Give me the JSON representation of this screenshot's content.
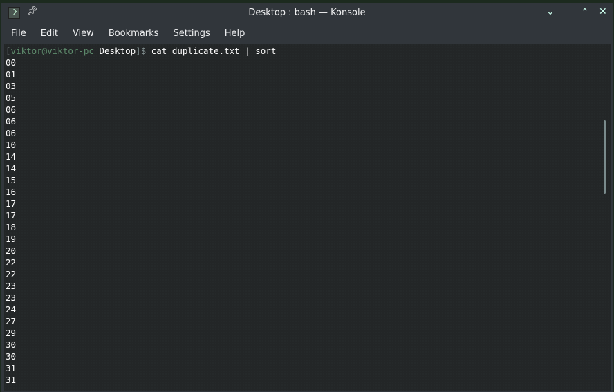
{
  "window": {
    "title": "Desktop : bash — Konsole"
  },
  "menu": [
    "File",
    "Edit",
    "View",
    "Bookmarks",
    "Settings",
    "Help"
  ],
  "terminal": {
    "prompt_open": "[",
    "prompt_user": "viktor@viktor-pc",
    "prompt_dir": " Desktop",
    "prompt_close": "]$",
    "command": " cat duplicate.txt | sort",
    "output": [
      "00",
      "01",
      "03",
      "05",
      "06",
      "06",
      "06",
      "10",
      "14",
      "14",
      "15",
      "16",
      "17",
      "17",
      "18",
      "19",
      "20",
      "22",
      "22",
      "23",
      "23",
      "24",
      "27",
      "29",
      "30",
      "30",
      "31",
      "31"
    ]
  }
}
